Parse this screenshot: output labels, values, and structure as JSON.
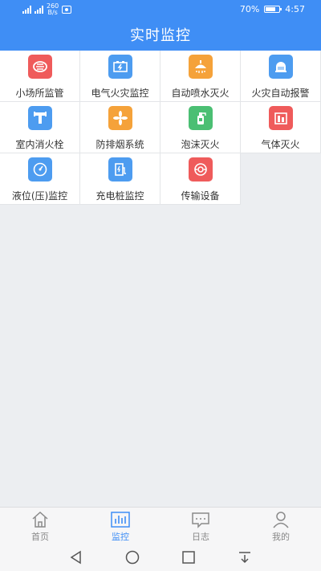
{
  "status_bar": {
    "network_speed": "260\nB/s",
    "battery": "70%",
    "time": "4:57"
  },
  "header": {
    "title": "实时监控"
  },
  "grid": [
    {
      "label": "小场所监管",
      "icon": "smoke-detector-icon",
      "color": "#ef5b5b"
    },
    {
      "label": "电气火灾监控",
      "icon": "battery-bolt-icon",
      "color": "#4d9cf0"
    },
    {
      "label": "自动喷水灭火",
      "icon": "sprinkler-icon",
      "color": "#f5a23a"
    },
    {
      "label": "火灾自动报警",
      "icon": "alarm-bell-icon",
      "color": "#4d9cf0"
    },
    {
      "label": "室内消火栓",
      "icon": "hydrant-icon",
      "color": "#4d9cf0"
    },
    {
      "label": "防排烟系统",
      "icon": "fan-icon",
      "color": "#f5a23a"
    },
    {
      "label": "泡沫灭火",
      "icon": "foam-extinguisher-icon",
      "color": "#4bbf73"
    },
    {
      "label": "气体灭火",
      "icon": "gas-extinguisher-icon",
      "color": "#ef5b5b"
    },
    {
      "label": "液位(压)监控",
      "icon": "pressure-gauge-icon",
      "color": "#4d9cf0"
    },
    {
      "label": "充电桩监控",
      "icon": "charging-pile-icon",
      "color": "#4d9cf0"
    },
    {
      "label": "传输设备",
      "icon": "transmission-device-icon",
      "color": "#ef5b5b"
    }
  ],
  "tabbar": {
    "home": "首页",
    "monitor": "监控",
    "log": "日志",
    "mine": "我的"
  },
  "colors": {
    "brand": "#3f8ef5",
    "background": "#eceef1"
  }
}
